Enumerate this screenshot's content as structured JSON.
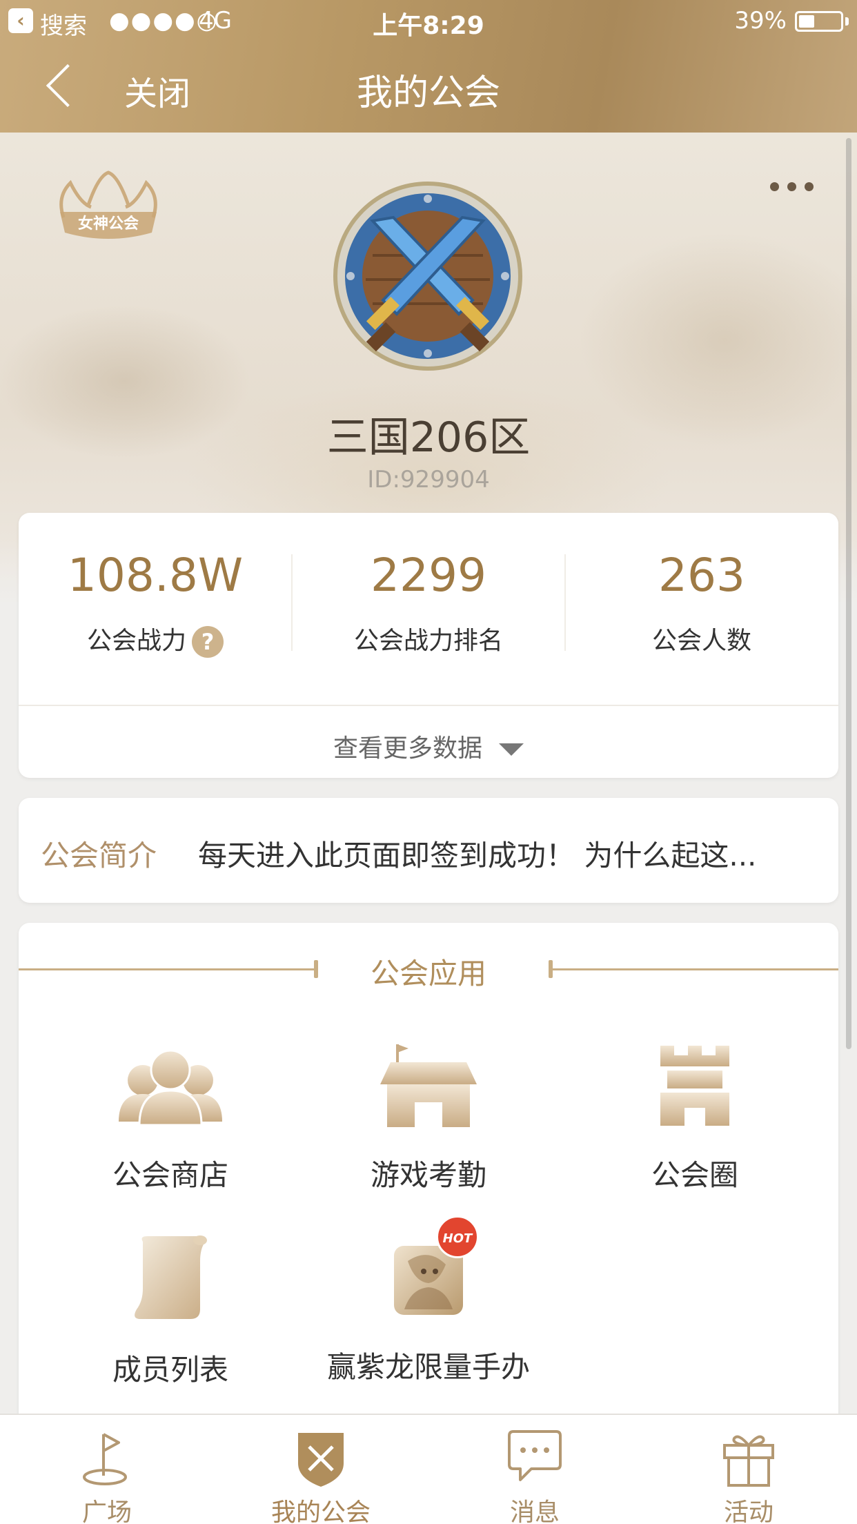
{
  "status_bar": {
    "back_label": "搜索",
    "signal": "●●●●○",
    "network": "4G",
    "time": "上午8:29",
    "battery": "39%"
  },
  "nav": {
    "close_label": "关闭",
    "title": "我的公会"
  },
  "guild": {
    "badge_text": "女神公会",
    "name": "三国206区",
    "id": "ID:929904"
  },
  "stats": [
    {
      "value": "108.8W",
      "label": "公会战力"
    },
    {
      "value": "2299",
      "label": "公会战力排名"
    },
    {
      "value": "263",
      "label": "公会人数"
    }
  ],
  "help_icon": "?",
  "more_data_label": "查看更多数据",
  "intro": {
    "label": "公会简介",
    "text": "每天进入此页面即签到成功！ 为什么起这..."
  },
  "apps": {
    "title": "公会应用",
    "items": [
      {
        "label": "公会商店",
        "icon": "people-icon"
      },
      {
        "label": "游戏考勤",
        "icon": "store-icon"
      },
      {
        "label": "公会圈",
        "icon": "castle-icon"
      },
      {
        "label": "成员列表",
        "icon": "scroll-icon"
      },
      {
        "label": "赢紫龙限量手办",
        "icon": "figure-icon",
        "badge": "HOT"
      }
    ]
  },
  "tabs": [
    {
      "label": "广场",
      "icon": "flag-icon",
      "active": false
    },
    {
      "label": "我的公会",
      "icon": "guild-shield-icon",
      "active": true
    },
    {
      "label": "消息",
      "icon": "chat-icon",
      "active": false
    },
    {
      "label": "活动",
      "icon": "gift-icon",
      "active": false
    }
  ],
  "colors": {
    "accent": "#b08e5c",
    "hot_badge": "#e2452f"
  }
}
